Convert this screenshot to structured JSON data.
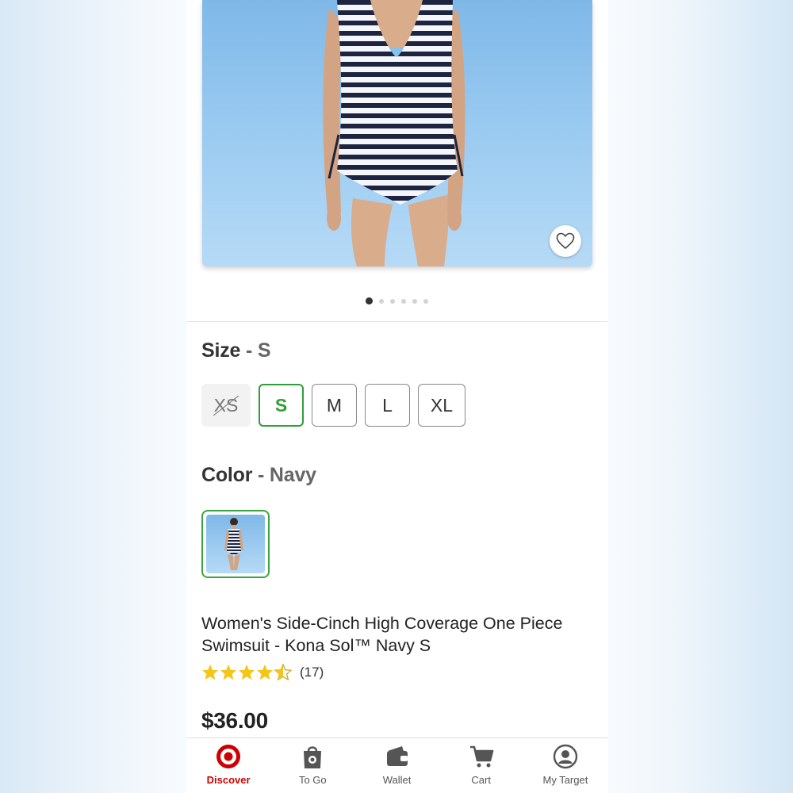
{
  "product": {
    "image_dots_total": 6,
    "image_dots_active": 1
  },
  "size": {
    "heading": "Size",
    "separator": "-",
    "selected": "S",
    "options": [
      {
        "label": "XS",
        "state": "unavailable"
      },
      {
        "label": "S",
        "state": "selected"
      },
      {
        "label": "M",
        "state": "available"
      },
      {
        "label": "L",
        "state": "available"
      },
      {
        "label": "XL",
        "state": "available"
      }
    ]
  },
  "color": {
    "heading": "Color",
    "separator": "-",
    "selected": "Navy",
    "accent": "#3aa53f"
  },
  "title": "Women's Side-Cinch High Coverage One Piece Swimsuit - Kona Sol™ Navy S",
  "rating": {
    "value": 4.5,
    "max": 5,
    "count_text": "(17)",
    "star_color": "#f5c518"
  },
  "price": "$36.00",
  "tabbar": {
    "active_color": "#cc0000",
    "tabs": [
      {
        "label": "Discover",
        "icon": "target-logo-icon",
        "active": true
      },
      {
        "label": "To Go",
        "icon": "shopping-bag-icon",
        "active": false
      },
      {
        "label": "Wallet",
        "icon": "wallet-icon",
        "active": false
      },
      {
        "label": "Cart",
        "icon": "cart-icon",
        "active": false
      },
      {
        "label": "My Target",
        "icon": "account-icon",
        "active": false
      }
    ]
  }
}
